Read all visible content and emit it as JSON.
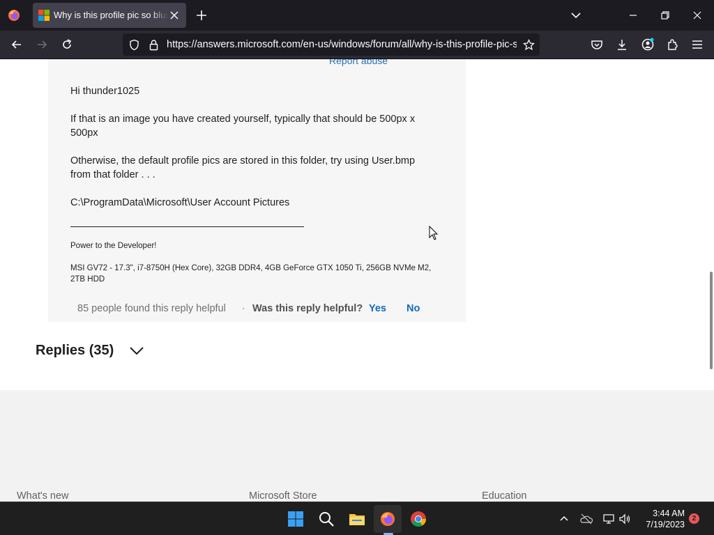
{
  "browser": {
    "tab_title": "Why is this profile pic so blurry?",
    "url": "https://answers.microsoft.com/en-us/windows/forum/all/why-is-this-profile-pic-so-blurry"
  },
  "post": {
    "report_abuse": "Report abuse",
    "greeting": "Hi thunder1025",
    "para1": "If that is an image you have created yourself, typically that should be 500px x 500px",
    "para2": "Otherwise, the default profile pics are stored in this folder, try using User.bmp from that folder . . .",
    "path": "C:\\ProgramData\\Microsoft\\User Account Pictures",
    "sig1": "Power to the Developer!",
    "sig2": "MSI GV72 - 17.3\", i7-8750H (Hex Core), 32GB DDR4, 4GB GeForce GTX 1050 Ti, 256GB NVMe M2, 2TB HDD",
    "helpful_count": "85 people found this reply helpful",
    "separator": "·",
    "question": "Was this reply helpful?",
    "yes": "Yes",
    "no": "No"
  },
  "replies": {
    "label": "Replies (35)"
  },
  "footer": {
    "col1": "What's new",
    "col2": "Microsoft Store",
    "col3": "Education"
  },
  "taskbar": {
    "time": "3:44 AM",
    "date": "7/19/2023",
    "notifications": "2"
  },
  "colors": {
    "link": "#0f6cbd",
    "card": "#f6f6f6",
    "footer": "#f2f2f2"
  }
}
